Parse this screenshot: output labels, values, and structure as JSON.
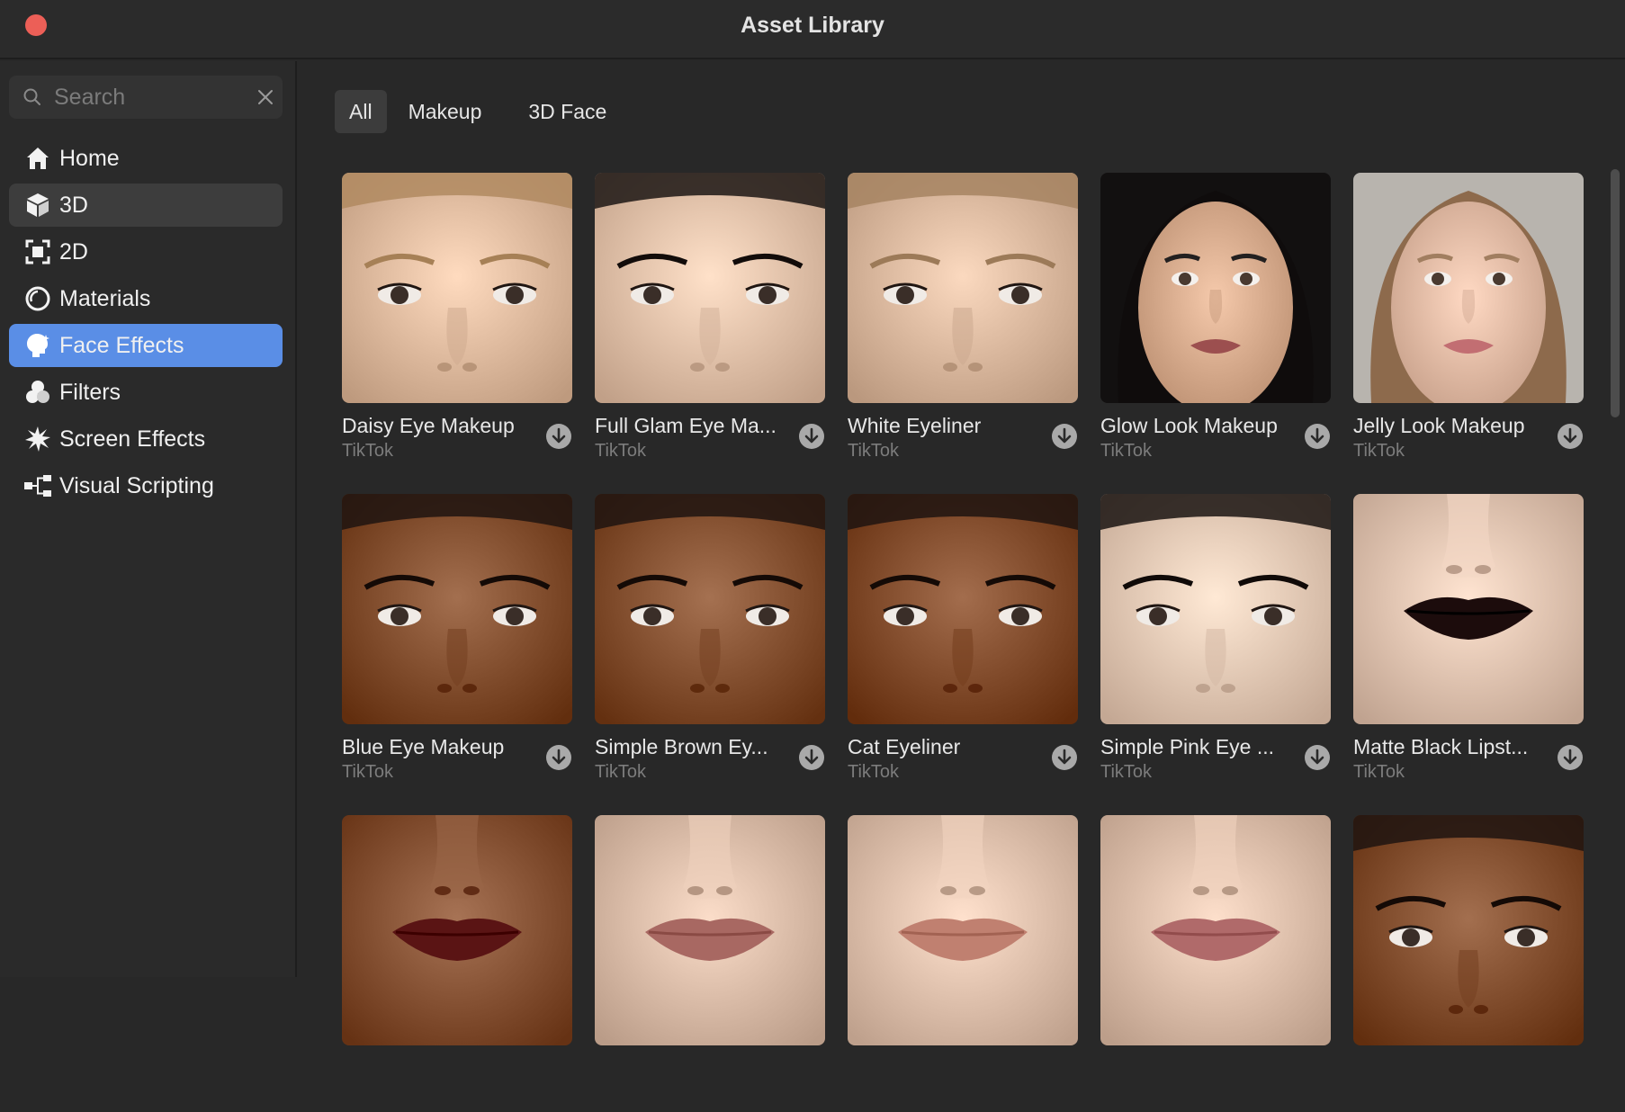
{
  "window": {
    "title": "Asset Library"
  },
  "search": {
    "placeholder": "Search",
    "value": ""
  },
  "sidebar": {
    "items": [
      {
        "label": "Home",
        "icon": "home-icon"
      },
      {
        "label": "3D",
        "icon": "cube-icon"
      },
      {
        "label": "2D",
        "icon": "frame-icon"
      },
      {
        "label": "Materials",
        "icon": "circle-icon"
      },
      {
        "label": "Face Effects",
        "icon": "face-effects-icon"
      },
      {
        "label": "Filters",
        "icon": "filters-icon"
      },
      {
        "label": "Screen Effects",
        "icon": "burst-icon"
      },
      {
        "label": "Visual Scripting",
        "icon": "node-graph-icon"
      }
    ],
    "selected": "Face Effects",
    "hovered": "3D"
  },
  "tabs": {
    "items": [
      "All",
      "Makeup",
      "3D Face"
    ],
    "selected": "All"
  },
  "assets": [
    {
      "name": "Daisy Eye Makeup",
      "author": "TikTok",
      "skin": "#e6c2a6",
      "hair": "#b08a60",
      "lips": "#c98a80",
      "crop": "eyes"
    },
    {
      "name": "Full Glam Eye Ma...",
      "author": "TikTok",
      "skin": "#e9c8b0",
      "hair": "#1c1614",
      "lips": "#c07a70",
      "crop": "eyes"
    },
    {
      "name": "White Eyeliner",
      "author": "TikTok",
      "skin": "#e2c0a6",
      "hair": "#a68462",
      "lips": "#c98a80",
      "crop": "eyes"
    },
    {
      "name": "Glow Look Makeup",
      "author": "TikTok",
      "skin": "#dcb092",
      "hair": "#0f0c0c",
      "lips": "#9c4f4f",
      "crop": "full"
    },
    {
      "name": "Jelly Look Makeup",
      "author": "TikTok",
      "skin": "#e7c0aa",
      "hair": "#8d6a4c",
      "lips": "#c26e72",
      "crop": "full"
    },
    {
      "name": "Blue Eye Makeup",
      "author": "TikTok",
      "skin": "#8a5636",
      "hair": "#1e1410",
      "lips": "#6a3a2a",
      "crop": "eyes"
    },
    {
      "name": "Simple Brown Ey...",
      "author": "TikTok",
      "skin": "#8c5838",
      "hair": "#1e1410",
      "lips": "#6a3a2a",
      "crop": "eyes"
    },
    {
      "name": "Cat Eyeliner",
      "author": "TikTok",
      "skin": "#8a5434",
      "hair": "#1e1410",
      "lips": "#6a3a2a",
      "crop": "eyes"
    },
    {
      "name": "Simple Pink Eye ...",
      "author": "TikTok",
      "skin": "#ecd0bc",
      "hair": "#1a1412",
      "lips": "#c07a70",
      "crop": "eyes"
    },
    {
      "name": "Matte Black Lipst...",
      "author": "TikTok",
      "skin": "#e8cbb8",
      "hair": "#e8cbb8",
      "lips": "#1c0c0c",
      "crop": "lips"
    },
    {
      "name": "",
      "author": "",
      "skin": "#8e5a3c",
      "hair": "#8e5a3c",
      "lips": "#5a1414",
      "crop": "lips"
    },
    {
      "name": "",
      "author": "",
      "skin": "#e2c4b0",
      "hair": "#e2c4b0",
      "lips": "#a86862",
      "crop": "lips"
    },
    {
      "name": "",
      "author": "",
      "skin": "#e6c8b4",
      "hair": "#e6c8b4",
      "lips": "#c08070",
      "crop": "lips"
    },
    {
      "name": "",
      "author": "",
      "skin": "#e4c6b2",
      "hair": "#e4c6b2",
      "lips": "#b06a6a",
      "crop": "lips"
    },
    {
      "name": "",
      "author": "",
      "skin": "#8a5636",
      "hair": "#1e1410",
      "lips": "#6a3a2a",
      "crop": "eyes"
    }
  ],
  "colors": {
    "accent": "#5a8ee6",
    "background": "#282828",
    "sidebar": "#2a2a2a",
    "close": "#ec5f57",
    "muted_text": "#7c7c7c"
  }
}
